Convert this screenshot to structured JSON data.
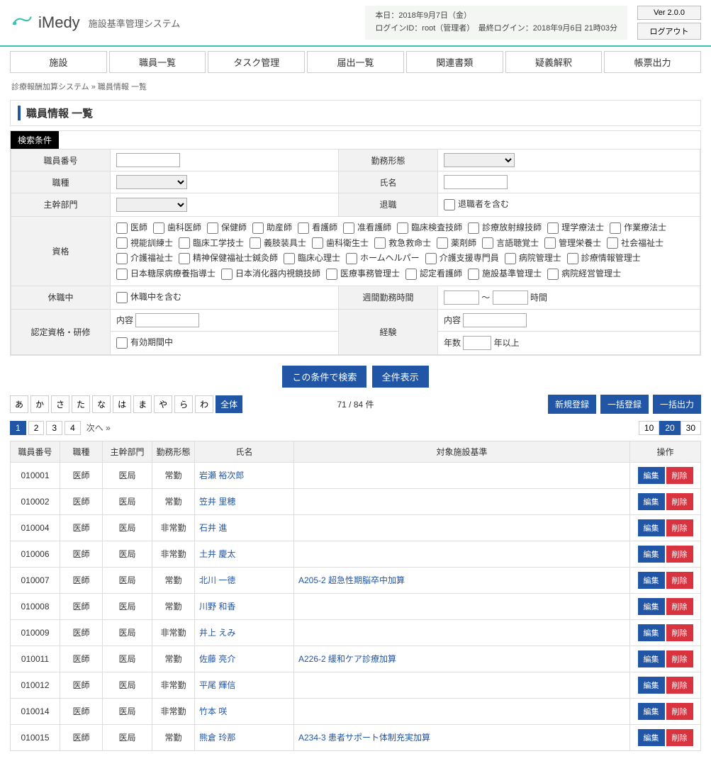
{
  "app": {
    "name": "iMedy",
    "subtitle": "施設基準管理システム",
    "version": "Ver 2.0.0",
    "logout": "ログアウト"
  },
  "session": {
    "today": "本日：2018年9月7日（金）",
    "login": "ログインID：root（管理者）　最終ログイン：2018年9月6日 21時03分"
  },
  "nav": [
    "施設",
    "職員一覧",
    "タスク管理",
    "届出一覧",
    "関連書類",
    "疑義解釈",
    "帳票出力"
  ],
  "breadcrumb": {
    "root": "診療報酬加算システム",
    "sep": "»",
    "current": "職員情報 一覧"
  },
  "page_title": "職員情報 一覧",
  "search": {
    "tab": "検索条件",
    "labels": {
      "id": "職員番号",
      "worktype": "勤務形態",
      "jobtype": "職種",
      "name": "氏名",
      "dept": "主幹部門",
      "retired": "退職",
      "retired_chk": "退職者を含む",
      "qual": "資格",
      "leave": "休職中",
      "leave_chk": "休職中を含む",
      "weekhours": "週間勤務時間",
      "hours_suffix": "時間",
      "tilde": "～",
      "cert": "認定資格・研修",
      "content": "内容",
      "valid": "有効期間中",
      "exp": "経験",
      "years": "年数",
      "years_suffix": "年以上"
    },
    "quals": [
      "医師",
      "歯科医師",
      "保健師",
      "助産師",
      "看護師",
      "准看護師",
      "臨床検査技師",
      "診療放射線技師",
      "理学療法士",
      "作業療法士",
      "視能訓練士",
      "臨床工学技士",
      "義肢装具士",
      "歯科衛生士",
      "救急救命士",
      "薬剤師",
      "言語聴覚士",
      "管理栄養士",
      "社会福祉士",
      "介護福祉士",
      "精神保健福祉士鍼灸師",
      "臨床心理士",
      "ホームヘルパー",
      "介護支援専門員",
      "病院管理士",
      "診療情報管理士",
      "日本糖尿病療養指導士",
      "日本消化器内視鏡技師",
      "医療事務管理士",
      "認定看護師",
      "施設基準管理士",
      "病院経営管理士"
    ]
  },
  "actions": {
    "search_btn": "この条件で検索",
    "show_all": "全件表示"
  },
  "kana": [
    "あ",
    "か",
    "さ",
    "た",
    "な",
    "は",
    "ま",
    "や",
    "ら",
    "わ",
    "全体"
  ],
  "kana_active": 10,
  "count": {
    "shown": "71",
    "sep": "/",
    "total": "84",
    "suffix": "件"
  },
  "reg_btns": {
    "new": "新規登録",
    "bulk_reg": "一括登録",
    "bulk_out": "一括出力"
  },
  "pages": [
    "1",
    "2",
    "3",
    "4"
  ],
  "page_active": 0,
  "next": "次へ »",
  "page_sizes": [
    "10",
    "20",
    "30"
  ],
  "page_size_active": 1,
  "cols": [
    "職員番号",
    "職種",
    "主幹部門",
    "勤務形態",
    "氏名",
    "対象施設基準",
    "操作"
  ],
  "op": {
    "edit": "編集",
    "del": "削除"
  },
  "rows": [
    {
      "id": "010001",
      "type": "医師",
      "dept": "医局",
      "work": "常勤",
      "name": "岩瀬 裕次郎",
      "target": ""
    },
    {
      "id": "010002",
      "type": "医師",
      "dept": "医局",
      "work": "常勤",
      "name": "笠井 里穂",
      "target": ""
    },
    {
      "id": "010004",
      "type": "医師",
      "dept": "医局",
      "work": "非常勤",
      "name": "石井 進",
      "target": ""
    },
    {
      "id": "010006",
      "type": "医師",
      "dept": "医局",
      "work": "非常勤",
      "name": "土井 慶太",
      "target": ""
    },
    {
      "id": "010007",
      "type": "医師",
      "dept": "医局",
      "work": "常勤",
      "name": "北川 一徳",
      "target": "A205-2 超急性期脳卒中加算"
    },
    {
      "id": "010008",
      "type": "医師",
      "dept": "医局",
      "work": "常勤",
      "name": "川野 和香",
      "target": ""
    },
    {
      "id": "010009",
      "type": "医師",
      "dept": "医局",
      "work": "非常勤",
      "name": "井上 えみ",
      "target": ""
    },
    {
      "id": "010011",
      "type": "医師",
      "dept": "医局",
      "work": "常勤",
      "name": "佐藤 亮介",
      "target": "A226-2 緩和ケア診療加算"
    },
    {
      "id": "010012",
      "type": "医師",
      "dept": "医局",
      "work": "非常勤",
      "name": "平尾 輝信",
      "target": ""
    },
    {
      "id": "010014",
      "type": "医師",
      "dept": "医局",
      "work": "非常勤",
      "name": "竹本 咲",
      "target": ""
    },
    {
      "id": "010015",
      "type": "医師",
      "dept": "医局",
      "work": "常勤",
      "name": "熊倉 玲那",
      "target": "A234-3 患者サポート体制充実加算"
    }
  ]
}
